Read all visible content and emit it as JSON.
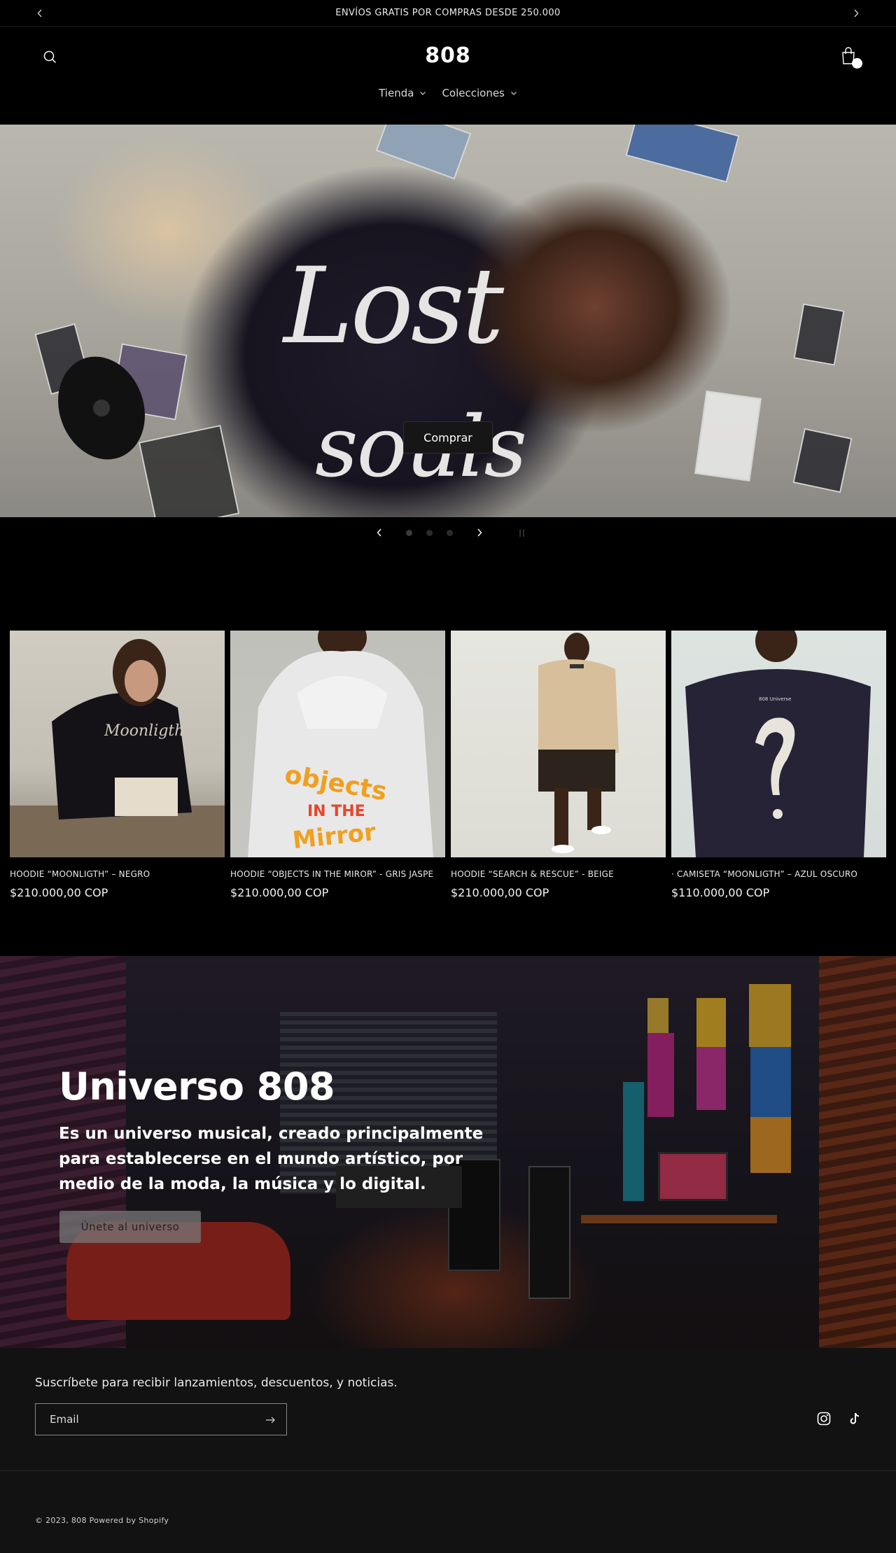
{
  "announcement": {
    "text": "ENVÍOS GRATIS POR COMPRAS DESDE 250.000",
    "prev_icon": "chevron-left-icon",
    "next_icon": "chevron-right-icon"
  },
  "header": {
    "logo": "808",
    "search_icon": "search-icon",
    "cart_icon": "bag-icon",
    "nav": [
      {
        "label": "Tienda"
      },
      {
        "label": "Colecciones"
      }
    ]
  },
  "hero": {
    "title_line1": "Lost",
    "title_line2": "souls",
    "button": "Comprar",
    "slides_count": 3,
    "active_slide": 1
  },
  "products": [
    {
      "name": "HOODIE “MOONLIGTH” – NEGRO",
      "price": "$210.000,00 COP"
    },
    {
      "name": "HOODIE “OBJECTS IN THE MIROR” - GRIS JASPE",
      "price": "$210.000,00 COP"
    },
    {
      "name": "HOODIE “SEARCH & RESCUE” - BEIGE",
      "price": "$210.000,00 COP"
    },
    {
      "name": "· CAMISETA “MOONLIGTH” – AZUL OSCURO",
      "price": "$110.000,00 COP"
    }
  ],
  "universe": {
    "title": "Universo 808",
    "text": "Es un universo musical, creado principalmente para establecerse en el mundo artístico, por medio de la moda, la música y lo digital.",
    "button": "Únete al universo"
  },
  "footer": {
    "subscribe_text": "Suscríbete para recibir lanzamientos, descuentos, y noticias.",
    "email_placeholder": "Email",
    "social": [
      "instagram-icon",
      "tiktok-icon"
    ],
    "copyright": "© 2023, 808 Powered by Shopify"
  },
  "colors": {
    "background": "#000000",
    "footer_bg": "#121212",
    "text": "#ffffff"
  }
}
